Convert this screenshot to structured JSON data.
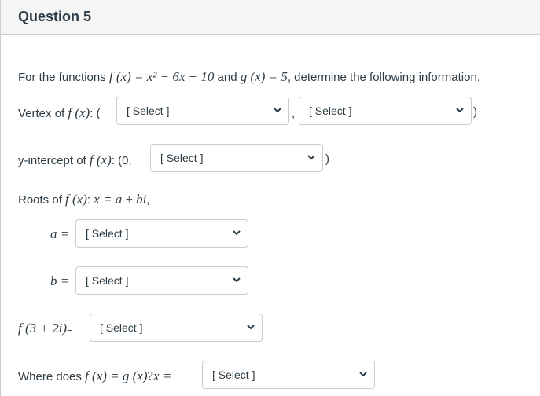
{
  "header": {
    "title": "Question 5"
  },
  "question": {
    "intro_prefix": "For the functions ",
    "f_def": "f (x) = x² − 6x + 10",
    "intro_and": " and ",
    "g_def": "g (x) = 5",
    "intro_suffix": ", determine the following information."
  },
  "vertex": {
    "label_prefix": "Vertex of ",
    "label_f": "f (x)",
    "label_suffix": ": (",
    "comma": ",",
    "close": ")",
    "select1": "[ Select ]",
    "select2": "[ Select ]"
  },
  "yint": {
    "label_prefix": "y-intercept of ",
    "label_f": "f (x)",
    "label_suffix": ": (0,",
    "close": ")",
    "select": "[ Select ]"
  },
  "roots": {
    "label_prefix": "Roots of ",
    "label_f": "f (x)",
    "label_colon": ": ",
    "label_math": "x = a ± bi",
    "label_end": ","
  },
  "a": {
    "label": "a =",
    "select": "[ Select ]"
  },
  "b": {
    "label": "b =",
    "select": "[ Select ]"
  },
  "f_eval": {
    "label": "f (3 + 2i)",
    "eq": "=",
    "select": "[ Select ]"
  },
  "intersect": {
    "label_prefix": "Where does ",
    "label_math": "f (x) = g (x)",
    "label_q": "? ",
    "label_x": "x =",
    "select": "[ Select ]"
  }
}
